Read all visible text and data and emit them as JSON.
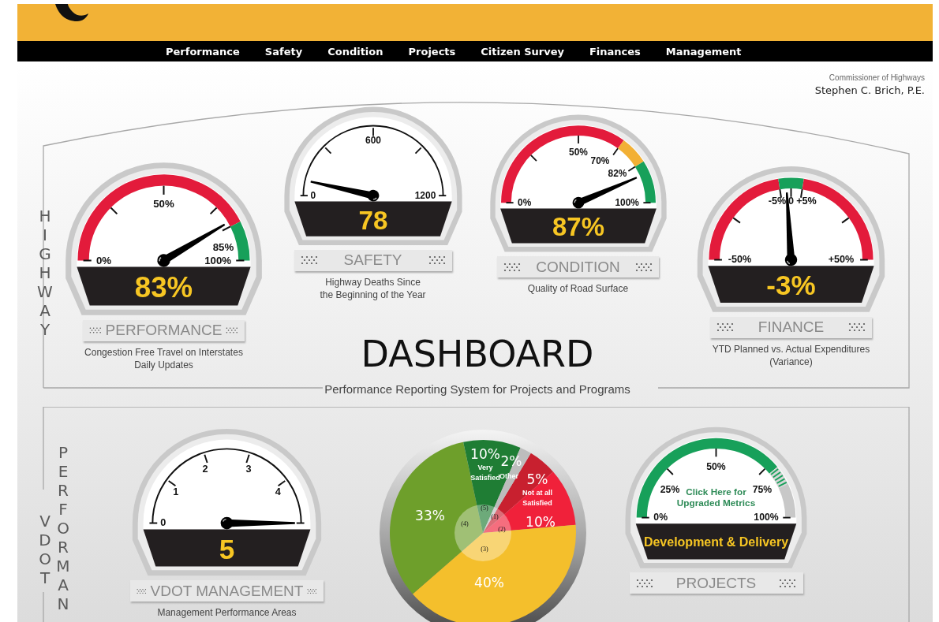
{
  "header": {
    "nav": [
      {
        "label": "Performance"
      },
      {
        "label": "Safety"
      },
      {
        "label": "Condition"
      },
      {
        "label": "Projects"
      },
      {
        "label": "Citizen Survey"
      },
      {
        "label": "Finances"
      },
      {
        "label": "Management"
      }
    ]
  },
  "commissioner": {
    "title": "Commissioner of Highways",
    "name": "Stephen C. Brich, P.E."
  },
  "highway": {
    "side_label": "HIGHWAY",
    "gauges": [
      {
        "title": "PERFORMANCE",
        "value": "83%",
        "scale": [
          "0%",
          "50%",
          "85%",
          "100%"
        ],
        "description_lines": [
          "Congestion Free Travel on Interstates",
          "Daily Updates"
        ]
      },
      {
        "title": "SAFETY",
        "value": "78",
        "scale": [
          "0",
          "600",
          "1200"
        ],
        "description_lines": [
          "Highway Deaths Since",
          "the Beginning of the Year"
        ]
      },
      {
        "title": "CONDITION",
        "value": "87%",
        "scale": [
          "0%",
          "50%",
          "70%",
          "82%",
          "100%"
        ],
        "description_lines": [
          "Quality of Road Surface"
        ]
      },
      {
        "title": "FINANCE",
        "value": "-3%",
        "scale": [
          "-50%",
          "-5%",
          "0",
          "+5%",
          "+50%"
        ],
        "description_lines": [
          "YTD Planned vs. Actual Expenditures",
          "(Variance)"
        ]
      }
    ],
    "heading": "DASHBOARD",
    "subtitle": "Performance Reporting System for Projects and Programs"
  },
  "vdot": {
    "side_labels": [
      "VDOT",
      "PERFORMAN"
    ],
    "gauges": [
      {
        "title": "VDOT MANAGEMENT",
        "value": "5",
        "scale": [
          "0",
          "1",
          "2",
          "3",
          "4"
        ],
        "description_lines": [
          "Management Performance Areas"
        ]
      },
      {
        "title": "PROJECTS",
        "value": "Development & Delivery",
        "scale": [
          "0%",
          "25%",
          "50%",
          "75%",
          "100%"
        ],
        "link_lines": [
          "Click Here for",
          "Upgraded Metrics"
        ]
      }
    ],
    "survey": {
      "chart_data": {
        "type": "donut",
        "categories": [
          "(1)",
          "(2)",
          "(3)",
          "(4)",
          "(5)",
          "Other"
        ],
        "values": [
          5,
          10,
          40,
          33,
          10,
          2
        ]
      },
      "slices": [
        {
          "value_label": "5%",
          "caption_lines": [
            "Not at all",
            "Satisfied"
          ]
        },
        {
          "value_label": "10%"
        },
        {
          "value_label": "40%"
        },
        {
          "value_label": "33%"
        },
        {
          "value_label": "10%",
          "caption_lines": [
            "Very",
            "Satisfied"
          ]
        },
        {
          "value_label": "2%"
        }
      ]
    }
  }
}
